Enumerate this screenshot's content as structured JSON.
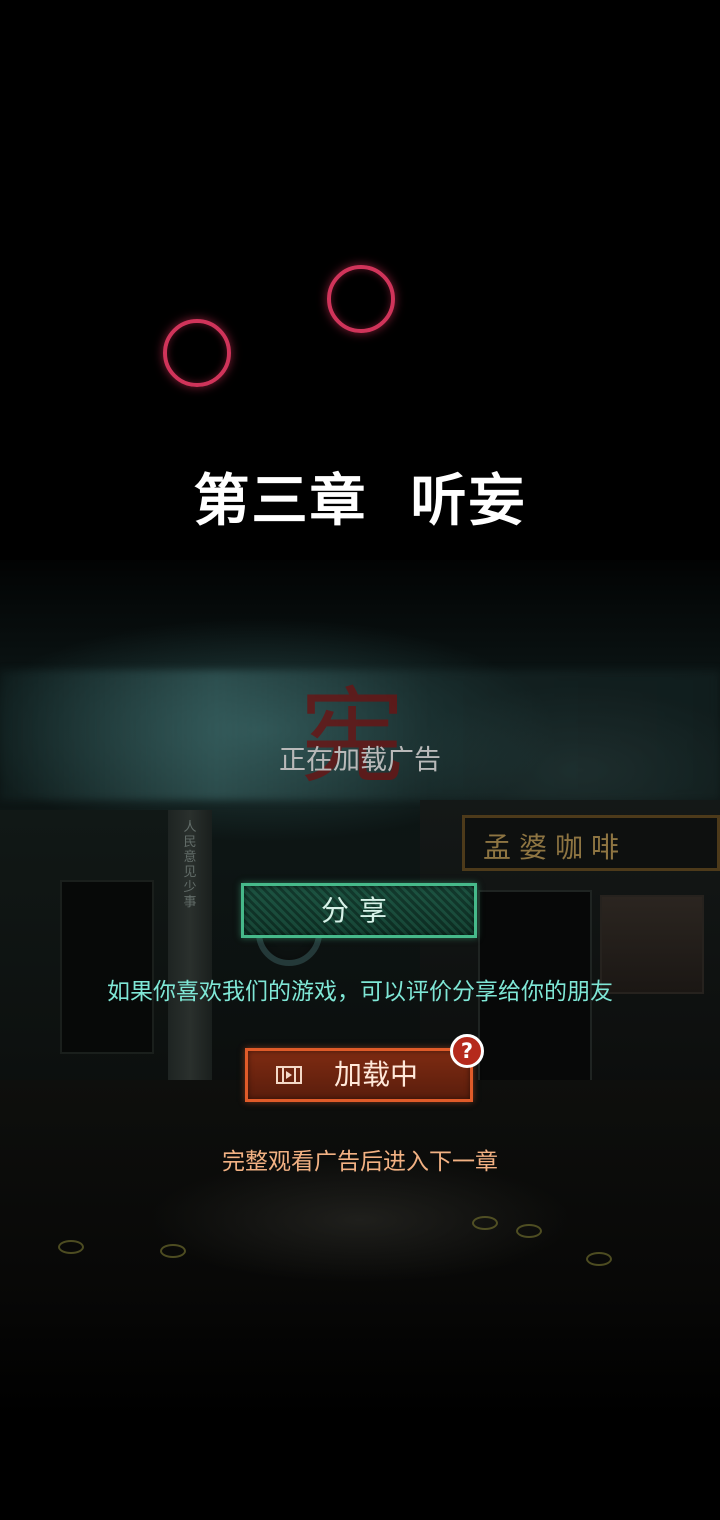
{
  "chapter": {
    "title": "第三章  听妄"
  },
  "loading": {
    "ad_status": "正在加载广告"
  },
  "share": {
    "button_label": "分享",
    "hint": "如果你喜欢我们的游戏，可以评价分享给你的朋友"
  },
  "watch_ad": {
    "button_label": "加载中",
    "help_symbol": "?",
    "hint": "完整观看广告后进入下一章",
    "icon": "film-play-icon"
  },
  "background": {
    "red_glyph": "宪",
    "shop_sign": "孟婆咖啡",
    "pillar_text": "人民意见少事"
  },
  "colors": {
    "ring": "#d0345a",
    "share_border": "#46b98a",
    "share_hint": "#7fe7d6",
    "watch_border": "#e05b29",
    "watch_hint": "#f2b183"
  }
}
